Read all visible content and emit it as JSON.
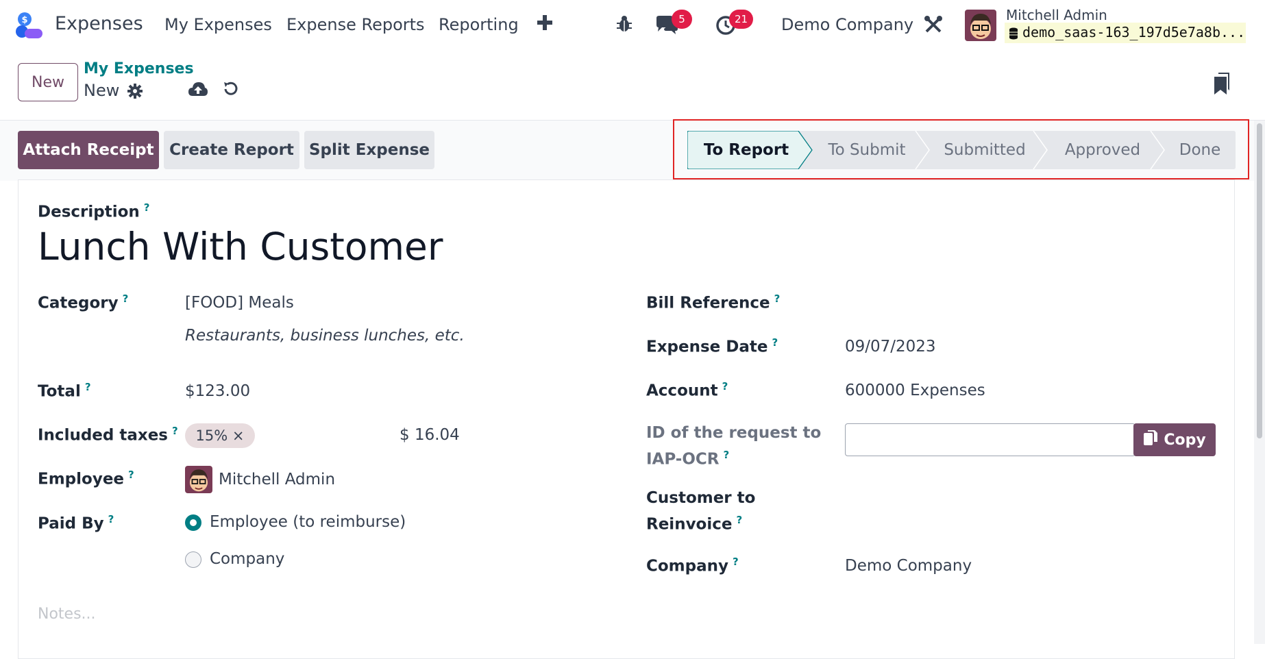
{
  "navbar": {
    "app_name": "Expenses",
    "menu": [
      "My Expenses",
      "Expense Reports",
      "Reporting"
    ],
    "messages_badge": "5",
    "activities_badge": "21",
    "company": "Demo Company",
    "user_name": "Mitchell Admin",
    "database": "demo_saas-163_197d5e7a8b..."
  },
  "control": {
    "new_label": "New",
    "breadcrumb": "My Expenses",
    "record_name": "New"
  },
  "actions": {
    "attach_receipt": "Attach Receipt",
    "create_report": "Create Report",
    "split_expense": "Split Expense"
  },
  "statusbar": {
    "stages": [
      "To Report",
      "To Submit",
      "Submitted",
      "Approved",
      "Done"
    ],
    "active": "To Report"
  },
  "form": {
    "description_label": "Description",
    "description": "Lunch With Customer",
    "category_label": "Category",
    "category": "[FOOD] Meals",
    "category_hint": "Restaurants, business lunches, etc.",
    "total_label": "Total",
    "total": "$123.00",
    "taxes_label": "Included taxes",
    "tax_tag": "15% ×",
    "tax_amount": "$ 16.04",
    "employee_label": "Employee",
    "employee": "Mitchell Admin",
    "paid_by_label": "Paid By",
    "paid_by_options": [
      "Employee (to reimburse)",
      "Company"
    ],
    "paid_by_selected": "Employee (to reimburse)",
    "bill_reference_label": "Bill Reference",
    "expense_date_label": "Expense Date",
    "expense_date": "09/07/2023",
    "account_label": "Account",
    "account": "600000 Expenses",
    "iap_label_1": "ID of the request to",
    "iap_label_2": "IAP-OCR",
    "copy_label": "Copy",
    "customer_label_1": "Customer to",
    "customer_label_2": "Reinvoice",
    "company_label": "Company",
    "company": "Demo Company",
    "notes_placeholder": "Notes..."
  },
  "colors": {
    "brand": "#714b67",
    "accent": "#017e84",
    "badge": "#e11d48",
    "highlight": "#e02424"
  }
}
